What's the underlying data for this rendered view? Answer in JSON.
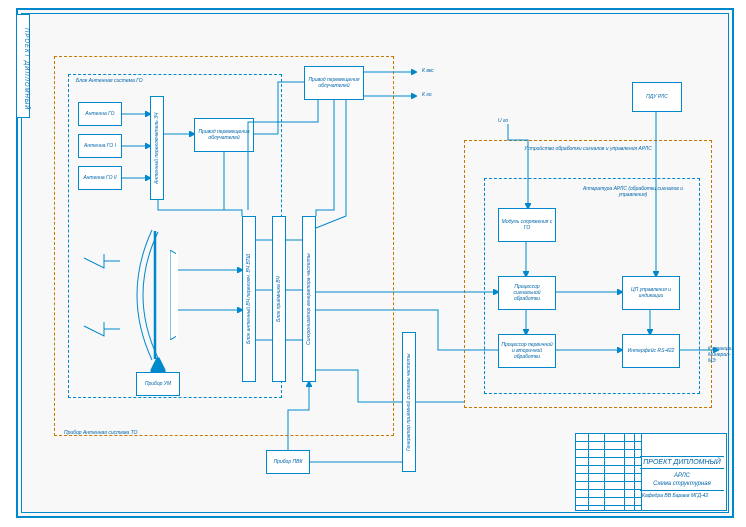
{
  "meta": {
    "side_tab": "ПРОЕКТ ДИПЛОМНЫЙ"
  },
  "titleblock": {
    "project": "ПРОЕКТ ДИПЛОМНЫЙ",
    "doc_title": "АРЛС",
    "doc_sub": "Схема структурная",
    "footer": "Кафедра ВВ Бараев МГД-42"
  },
  "groups": {
    "antenna_go": "Блок Антенная система ГО",
    "antenna_to": "Прибор Антенная система ТО",
    "proc_unit": "Устройство обработки сигналов и управления АРЛС",
    "apparatus": "Аппаратура АРЛС (обработки сигналов и управления)"
  },
  "blocks": {
    "ant_go": "Антенна ГО",
    "ant_go1": "Антенна ГО I",
    "ant_go2": "Антенна ГО II",
    "switch_3ch": "Антенный переключатель 3Ч",
    "drive1": "Привод перемещения облучателей",
    "drive2": "Привод перемещения облучателей",
    "um": "Прибор УМ",
    "pvk": "Прибор ПВК",
    "vert_b1": "Блок антенный ВЧ переключ. ВЧ ВТШ",
    "vert_b2": "Блок приёмника ВЧ",
    "vert_b3": "Синхронизатор генератора частоты",
    "generator": "Генератор приёмной системы частоты",
    "mod_sopr": "Модуль сопряжения с ГО",
    "proc_sig": "Процессор сигнальной обработки",
    "proc_prim": "Процессор первичной и вторичной обработки",
    "cp": "ЦП управления и индикации",
    "rs422": "Интерфейс RS-422",
    "pdu": "ПДУ РЛС"
  },
  "io": {
    "k_vks": "К вкс",
    "k_go": "К го",
    "u_go": "U го",
    "k_stan": "К станции Минерал-МЭ"
  }
}
